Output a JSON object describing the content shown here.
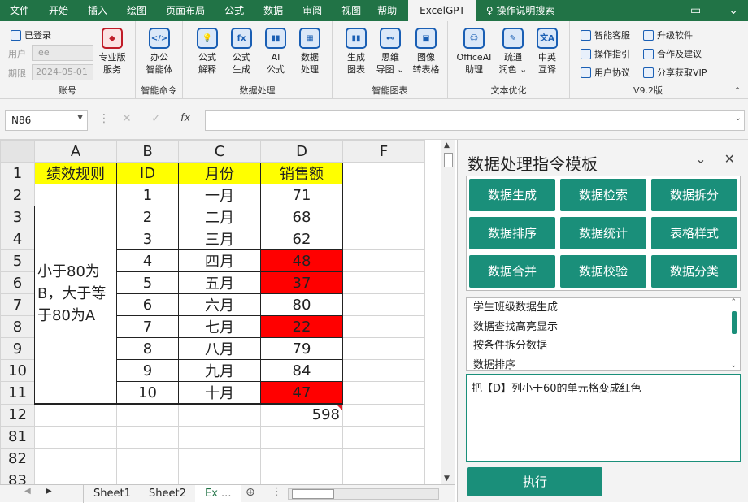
{
  "tabs": [
    "文件",
    "开始",
    "插入",
    "绘图",
    "页面布局",
    "公式",
    "数据",
    "审阅",
    "视图",
    "帮助",
    "ExcelGPT",
    "操作说明搜索"
  ],
  "account": {
    "logged": "已登录",
    "user_label": "用户",
    "user_value": "lee",
    "date_label": "期限",
    "date_value": "2024-05-01",
    "pro_label1": "专业版",
    "pro_label2": "服务",
    "group": "账号"
  },
  "smart": {
    "b1": "办公",
    "b2": "智能体",
    "group": "智能命令"
  },
  "dataproc": {
    "buttons": [
      [
        "公式",
        "解释"
      ],
      [
        "公式",
        "生成"
      ],
      [
        "AI",
        "公式"
      ],
      [
        "数据",
        "处理"
      ]
    ],
    "group": "数据处理"
  },
  "charts": {
    "buttons": [
      [
        "生成",
        "图表"
      ],
      [
        "思维",
        "导图 ⌄"
      ],
      [
        "图像",
        "转表格"
      ]
    ],
    "group": "智能图表"
  },
  "textopt": {
    "buttons": [
      [
        "OfficeAI",
        "助理"
      ],
      [
        "疏通",
        "润色 ⌄"
      ],
      [
        "中英",
        "互译"
      ]
    ],
    "group": "文本优化"
  },
  "misc": {
    "items": [
      "智能客服",
      "升级软件",
      "操作指引",
      "合作及建议",
      "用户协议",
      "分享获取VIP"
    ],
    "group": "V9.2版"
  },
  "namebox": "N86",
  "fx": "fx",
  "cols": [
    "A",
    "B",
    "C",
    "D",
    "F"
  ],
  "header": {
    "a": "绩效规则",
    "b": "ID",
    "c": "月份",
    "d": "销售额"
  },
  "rule_text": "小于80为B，大于等于80为A",
  "rows": [
    {
      "r": "2",
      "id": "1",
      "m": "一月",
      "v": "71"
    },
    {
      "r": "3",
      "id": "2",
      "m": "二月",
      "v": "68"
    },
    {
      "r": "4",
      "id": "3",
      "m": "三月",
      "v": "62"
    },
    {
      "r": "5",
      "id": "4",
      "m": "四月",
      "v": "48"
    },
    {
      "r": "6",
      "id": "5",
      "m": "五月",
      "v": "37"
    },
    {
      "r": "7",
      "id": "6",
      "m": "六月",
      "v": "80"
    },
    {
      "r": "8",
      "id": "7",
      "m": "七月",
      "v": "22"
    },
    {
      "r": "9",
      "id": "8",
      "m": "八月",
      "v": "79"
    },
    {
      "r": "10",
      "id": "9",
      "m": "九月",
      "v": "84"
    },
    {
      "r": "11",
      "id": "10",
      "m": "十月",
      "v": "47"
    }
  ],
  "extra_rows": [
    "12",
    "81",
    "82",
    "83"
  ],
  "total": "598",
  "sheets": [
    "Sheet1",
    "Sheet2",
    "Ex"
  ],
  "panel": {
    "title": "数据处理指令模板",
    "buttons": [
      "数据生成",
      "数据检索",
      "数据拆分",
      "数据排序",
      "数据统计",
      "表格样式",
      "数据合并",
      "数据校验",
      "数据分类"
    ],
    "list": [
      "学生班级数据生成",
      "数据查找高亮显示",
      "按条件拆分数据",
      "数据排序"
    ],
    "command": "把【D】列小于60的单元格变成红色",
    "exec": "执行"
  },
  "colors": {
    "accent": "#217346",
    "panel_btn": "#1a8f7a",
    "highlight": "#ff0000",
    "header": "#ffff00"
  }
}
